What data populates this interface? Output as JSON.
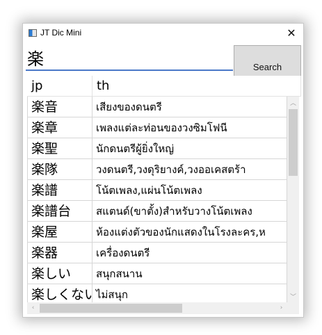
{
  "window": {
    "title": "JT Dic Mini",
    "close_glyph": "✕"
  },
  "search": {
    "value": "楽",
    "button_label": "Search"
  },
  "grid": {
    "columns": [
      "jp",
      "th"
    ],
    "rows": [
      {
        "jp": "楽音",
        "th": "เสียงของดนตรี"
      },
      {
        "jp": "楽章",
        "th": "เพลงแต่ละท่อนของวงซิมโฟนี"
      },
      {
        "jp": "楽聖",
        "th": "นักดนตรีผู้ยิ่งใหญ่"
      },
      {
        "jp": "楽隊",
        "th": "วงดนตรี,วงดุริยางค์,วงออเคสตร้า"
      },
      {
        "jp": "楽譜",
        "th": "โน้ตเพลง,แผ่นโน้ตเพลง"
      },
      {
        "jp": "楽譜台",
        "th": "สแตนด์(ขาตั้ง)สำหรับวางโน้ตเพลง"
      },
      {
        "jp": "楽屋",
        "th": "ห้องแต่งตัวของนักแสดงในโรงละคร,ห"
      },
      {
        "jp": "楽器",
        "th": "เครื่องดนตรี"
      },
      {
        "jp": "楽しい",
        "th": "สนุกสนาน"
      },
      {
        "jp": "楽しくない",
        "th": "ไม่สนุก"
      }
    ]
  },
  "icons": {
    "app": "dictionary-app-icon",
    "close": "close-icon",
    "scroll_up": "scroll-up-arrow-icon",
    "scroll_down": "scroll-down-arrow-icon",
    "scroll_left": "scroll-left-arrow-icon",
    "scroll_right": "scroll-right-arrow-icon"
  },
  "colors": {
    "accent": "#4a78c8",
    "button_bg": "#dddddd",
    "scroll_thumb": "#cdcdcd"
  }
}
